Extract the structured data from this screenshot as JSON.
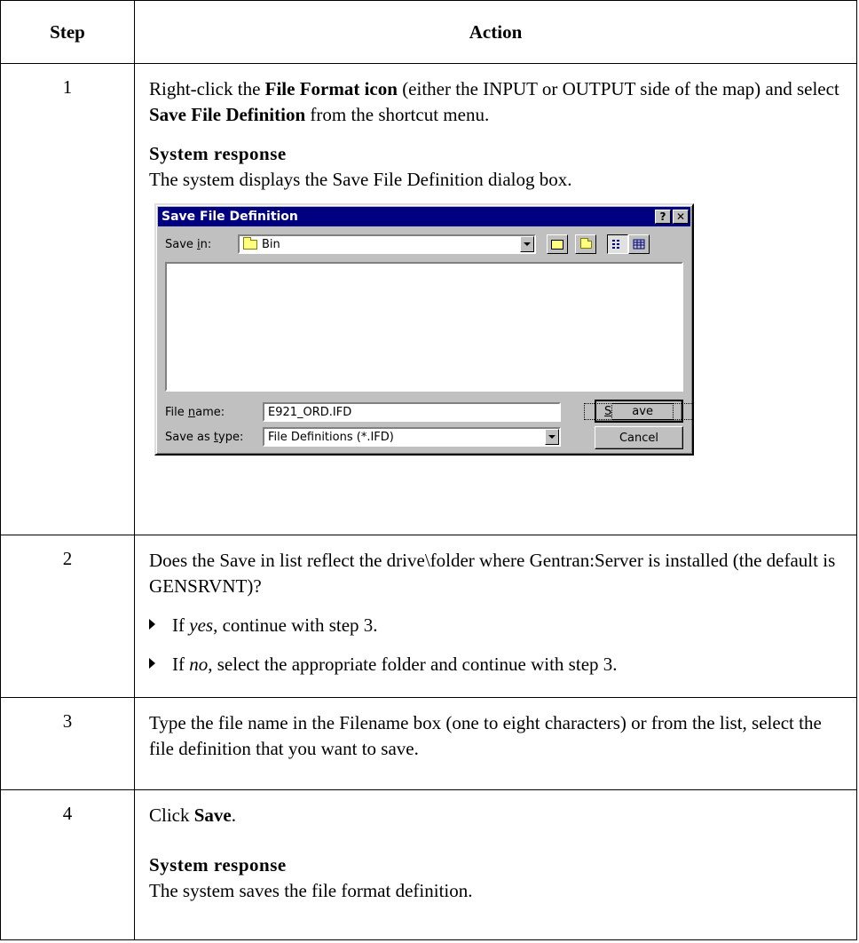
{
  "table": {
    "header_step": "Step",
    "header_action": "Action"
  },
  "steps": [
    {
      "num": "1",
      "p1_a": "Right-click the ",
      "p1_b": "File Format icon",
      "p1_c": " (either the INPUT or OUTPUT side of the map) and select ",
      "p1_d": "Save File Definition",
      "p1_e": " from the shortcut menu.",
      "sys_head": "System response",
      "sys_text": "The system displays the Save File Definition dialog box."
    },
    {
      "num": "2",
      "p1": "Does the Save in list reflect the drive\\folder where Gentran:Server is installed (the default is GENSRVNT)?",
      "b1_a": "If ",
      "b1_b": "yes",
      "b1_c": ", continue with step 3.",
      "b2_a": "If ",
      "b2_b": "no",
      "b2_c": ", select the appropriate folder and continue with step 3."
    },
    {
      "num": "3",
      "p1": "Type the file name in the Filename box (one to eight characters) or from the list, select the file definition that you want to save."
    },
    {
      "num": "4",
      "p1_a": "Click ",
      "p1_b": "Save",
      "p1_c": ".",
      "sys_head": "System response",
      "sys_text": "The system saves the file format definition."
    }
  ],
  "dialog": {
    "title": "Save File Definition",
    "help_glyph": "?",
    "close_glyph": "✕",
    "save_in_label_pre": "Save ",
    "save_in_label_ul": "i",
    "save_in_label_post": "n:",
    "save_in_value": "Bin",
    "file_name_label_pre": "File ",
    "file_name_label_ul": "n",
    "file_name_label_post": "ame:",
    "file_name_value": "E921_ORD.IFD",
    "save_type_label_pre": "Save as ",
    "save_type_label_ul": "t",
    "save_type_label_post": "ype:",
    "save_type_value": "File Definitions (*.IFD)",
    "save_button_ul": "S",
    "save_button_rest": "ave",
    "cancel_button": "Cancel"
  }
}
